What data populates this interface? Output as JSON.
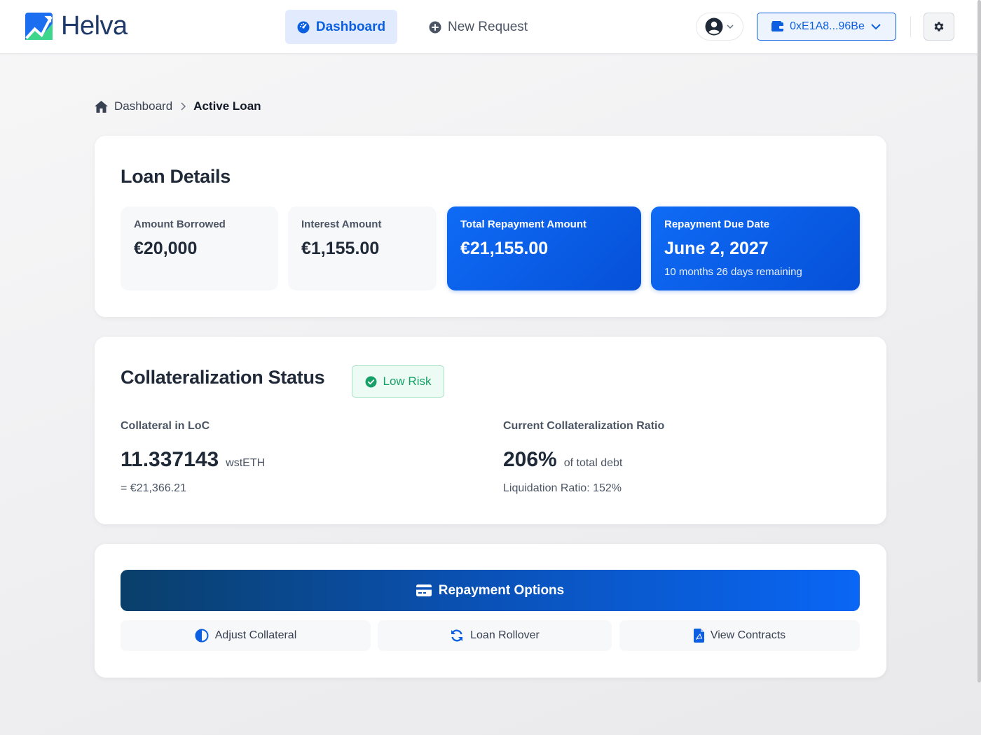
{
  "header": {
    "brand": "Helva",
    "nav": {
      "dashboard_label": "Dashboard",
      "new_request_label": "New Request"
    },
    "wallet_address": "0xE1A8...96Be"
  },
  "breadcrumb": {
    "home": "Dashboard",
    "current": "Active Loan"
  },
  "loan_details": {
    "title": "Loan Details",
    "stats": [
      {
        "label": "Amount Borrowed",
        "value": "€20,000"
      },
      {
        "label": "Interest Amount",
        "value": "€1,155.00"
      },
      {
        "label": "Total Repayment Amount",
        "value": "€21,155.00"
      },
      {
        "label": "Repayment Due Date",
        "value": "June 2, 2027",
        "sub": "10 months 26 days remaining"
      }
    ]
  },
  "collateral": {
    "title": "Collateralization Status",
    "risk_badge": "Low Risk",
    "collateral_label": "Collateral in LoC",
    "collateral_amount": "11.337143",
    "collateral_unit": "wstETH",
    "collateral_value": "= €21,366.21",
    "ratio_label": "Current Collateralization Ratio",
    "ratio_value": "206%",
    "ratio_unit": "of total debt",
    "liquidation": "Liquidation Ratio: 152%"
  },
  "actions": {
    "repayment_options": "Repayment Options",
    "adjust_collateral": "Adjust Collateral",
    "loan_rollover": "Loan Rollover",
    "view_contracts": "View Contracts"
  },
  "colors": {
    "primary": "#0b5fe0",
    "success": "#16a067",
    "brand_navy": "#1f3a68",
    "brand_green": "#3dd68c"
  },
  "icons": [
    "logo-icon",
    "gauge-icon",
    "plus-circle-icon",
    "user-circle-icon",
    "chevron-down-icon",
    "wallet-icon",
    "gear-icon",
    "home-icon",
    "chevron-right-icon",
    "check-circle-icon",
    "credit-card-icon",
    "half-circle-icon",
    "refresh-icon",
    "file-pdf-icon"
  ]
}
